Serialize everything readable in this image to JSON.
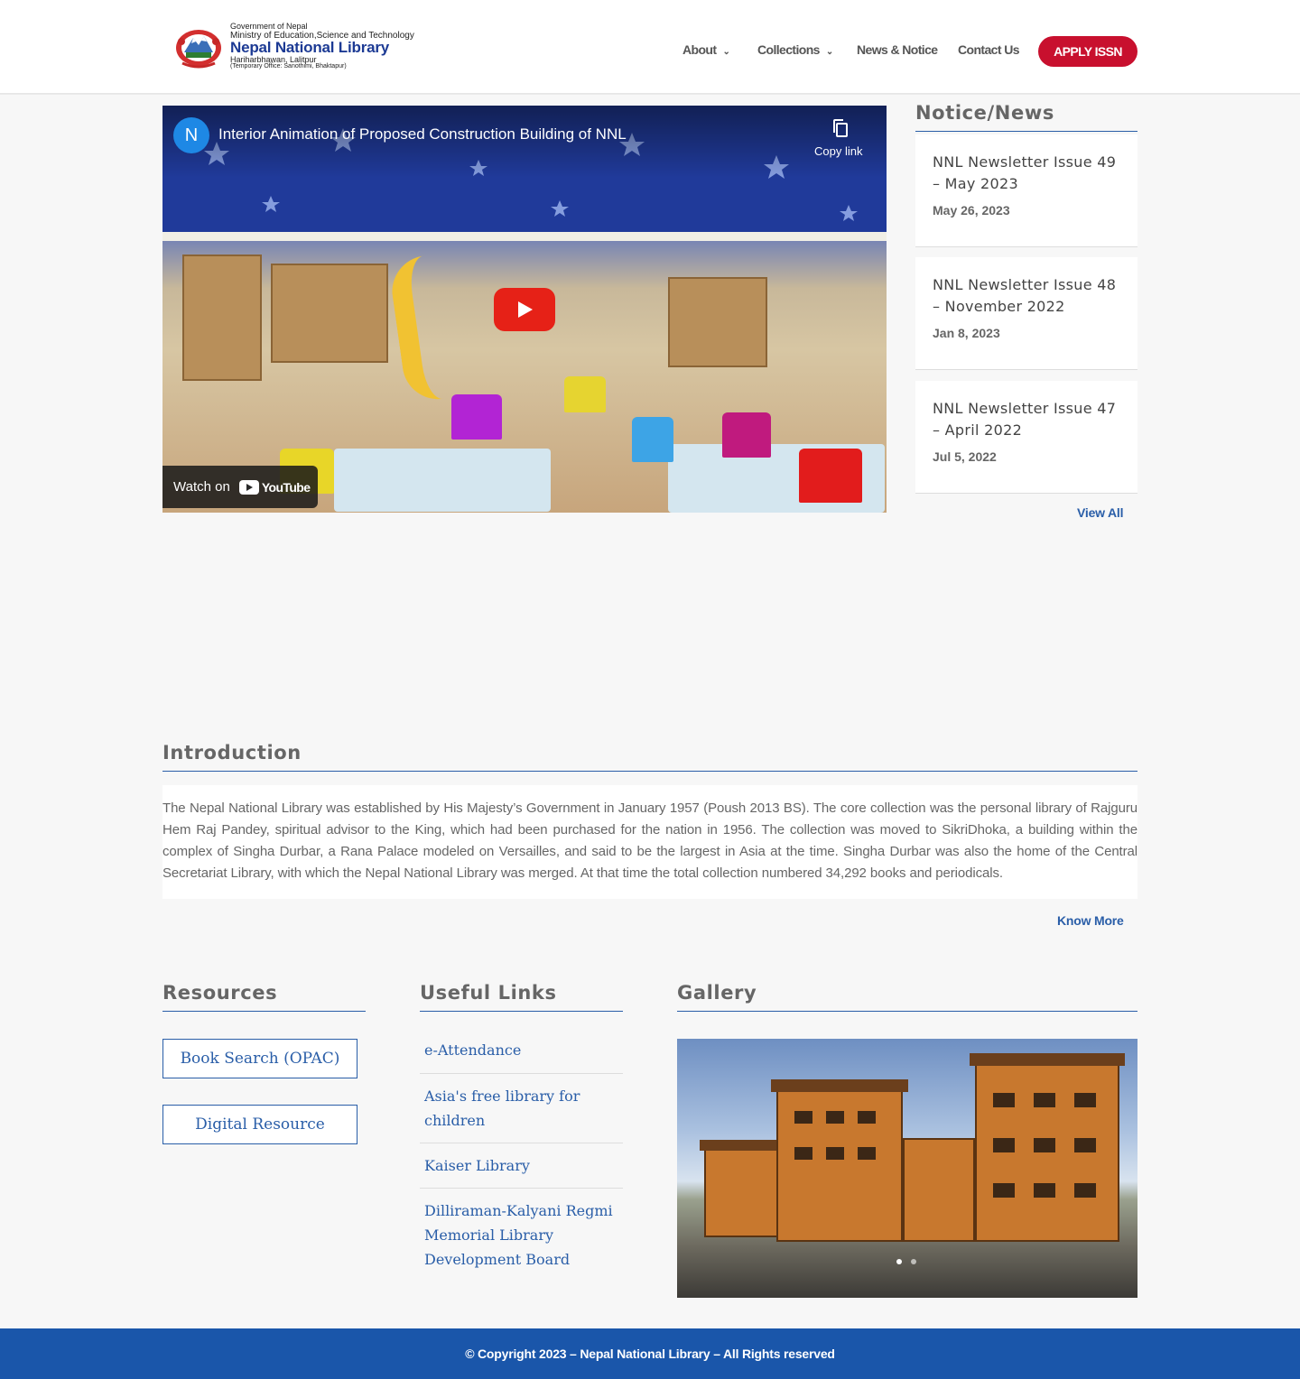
{
  "header": {
    "logo": {
      "line1": "Government of Nepal",
      "line2": "Ministry of Education,Science and Technology",
      "line3": "Nepal National Library",
      "line4": "Hariharbhawan, Lalitpur",
      "line5": "(Temporary Office: Sanothimi, Bhaktapur)"
    },
    "nav": [
      {
        "label": "About",
        "has_dropdown": true,
        "dropdown_icon": "chevron-down-icon"
      },
      {
        "label": "Collections",
        "has_dropdown": true,
        "dropdown_icon": "chevron-down-icon"
      },
      {
        "label": "News & Notice",
        "has_dropdown": false
      },
      {
        "label": "Contact Us",
        "has_dropdown": false
      }
    ],
    "apply_button": "APPLY ISSN"
  },
  "video": {
    "channel_initial": "N",
    "title": "Interior Animation of Proposed Construction Building of NNL",
    "copy_label": "Copy link",
    "watch_on": "Watch on",
    "youtube_label": "YouTube",
    "icons": [
      "copy-icon",
      "play-icon",
      "youtube-logo-icon"
    ]
  },
  "notice": {
    "title": "Notice/News",
    "items": [
      {
        "title": "NNL Newsletter Issue 49 – May 2023",
        "date": "May 26, 2023"
      },
      {
        "title": "NNL Newsletter Issue 48 – November 2022",
        "date": "Jan 8, 2023"
      },
      {
        "title": "NNL Newsletter Issue 47 – April 2022",
        "date": "Jul 5, 2022"
      }
    ],
    "view_all": "View All"
  },
  "introduction": {
    "title": "Introduction",
    "text": "The Nepal National Library was established by His Majesty’s Government in January 1957 (Poush 2013 BS). The core collection was the personal library of Rajguru Hem Raj Pandey, spiritual advisor to the King, which had been purchased for the nation in 1956. The collection was moved to SikriDhoka, a building within the complex of Singha Durbar, a Rana Palace modeled on Versailles, and said to be the largest in Asia at the time. Singha Durbar was also the home of the Central Secretariat Library, with which the Nepal National Library was merged. At that time the total collection numbered 34,292 books and periodicals.",
    "know_more": "Know More"
  },
  "resources": {
    "title": "Resources",
    "buttons": [
      "Book Search (OPAC)",
      "Digital Resource"
    ]
  },
  "useful_links": {
    "title": "Useful Links",
    "items": [
      "e-Attendance",
      "Asia's free library for children",
      "Kaiser Library",
      "Dilliraman-Kalyani Regmi Memorial Library Development Board"
    ]
  },
  "gallery": {
    "title": "Gallery",
    "slide_count": 2,
    "active_slide": 1
  },
  "footer": {
    "text": "© Copyright 2023 – Nepal National Library – All Rights reserved"
  },
  "colors": {
    "accent_blue": "#2a5ea8",
    "footer_blue": "#1a56aa",
    "apply_red": "#c8102e",
    "youtube_red": "#e62117"
  }
}
